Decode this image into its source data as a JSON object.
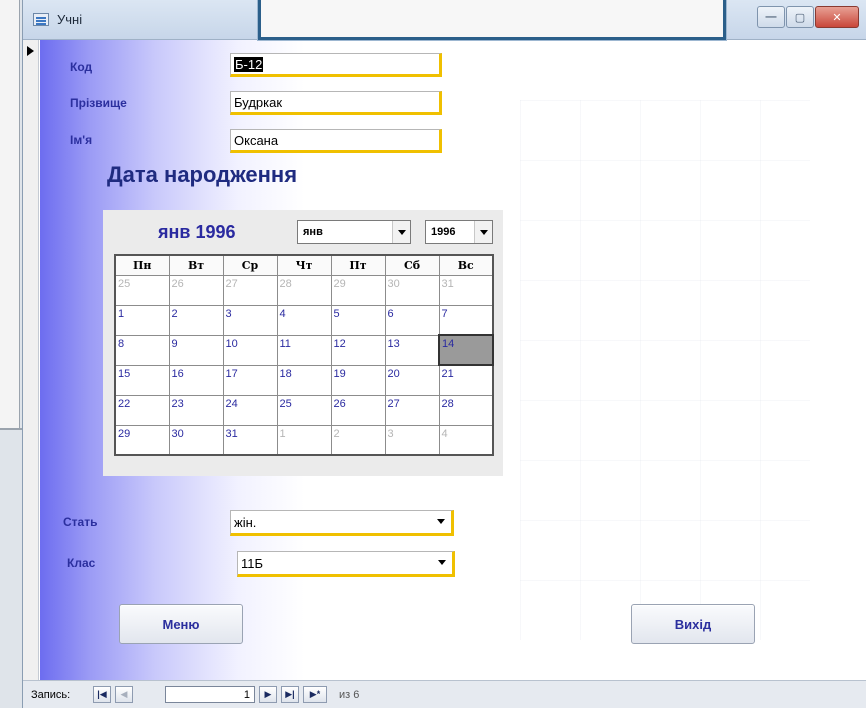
{
  "window": {
    "title": "Учні",
    "minimize": "—",
    "maximize": "▢",
    "close": "✕"
  },
  "form": {
    "code_label": "Код",
    "code_value": "Б-12",
    "surname_label": "Прізвище",
    "surname_value": "Будркак",
    "name_label": "Ім'я",
    "name_value": "Оксана",
    "dob_heading": "Дата народження",
    "gender_label": "Стать",
    "gender_value": "жін.",
    "class_label": "Клас",
    "class_value": "11Б",
    "menu_button": "Меню",
    "exit_button": "Вихід"
  },
  "calendar": {
    "month_title": "янв 1996",
    "month_select": "янв",
    "year_select": "1996",
    "weekdays": [
      "Пн",
      "Вт",
      "Ср",
      "Чт",
      "Пт",
      "Сб",
      "Вс"
    ],
    "weeks": [
      [
        {
          "d": "25",
          "t": "oth"
        },
        {
          "d": "26",
          "t": "oth"
        },
        {
          "d": "27",
          "t": "oth"
        },
        {
          "d": "28",
          "t": "oth"
        },
        {
          "d": "29",
          "t": "oth"
        },
        {
          "d": "30",
          "t": "oth"
        },
        {
          "d": "31",
          "t": "oth"
        }
      ],
      [
        {
          "d": "1",
          "t": "cur"
        },
        {
          "d": "2",
          "t": "cur"
        },
        {
          "d": "3",
          "t": "cur"
        },
        {
          "d": "4",
          "t": "cur"
        },
        {
          "d": "5",
          "t": "cur"
        },
        {
          "d": "6",
          "t": "cur"
        },
        {
          "d": "7",
          "t": "cur"
        }
      ],
      [
        {
          "d": "8",
          "t": "cur"
        },
        {
          "d": "9",
          "t": "cur"
        },
        {
          "d": "10",
          "t": "cur"
        },
        {
          "d": "11",
          "t": "cur"
        },
        {
          "d": "12",
          "t": "cur"
        },
        {
          "d": "13",
          "t": "cur"
        },
        {
          "d": "14",
          "t": "sel"
        }
      ],
      [
        {
          "d": "15",
          "t": "cur"
        },
        {
          "d": "16",
          "t": "cur"
        },
        {
          "d": "17",
          "t": "cur"
        },
        {
          "d": "18",
          "t": "cur"
        },
        {
          "d": "19",
          "t": "cur"
        },
        {
          "d": "20",
          "t": "cur"
        },
        {
          "d": "21",
          "t": "cur"
        }
      ],
      [
        {
          "d": "22",
          "t": "cur"
        },
        {
          "d": "23",
          "t": "cur"
        },
        {
          "d": "24",
          "t": "cur"
        },
        {
          "d": "25",
          "t": "cur"
        },
        {
          "d": "26",
          "t": "cur"
        },
        {
          "d": "27",
          "t": "cur"
        },
        {
          "d": "28",
          "t": "cur"
        }
      ],
      [
        {
          "d": "29",
          "t": "cur"
        },
        {
          "d": "30",
          "t": "cur"
        },
        {
          "d": "31",
          "t": "cur"
        },
        {
          "d": "1",
          "t": "oth"
        },
        {
          "d": "2",
          "t": "oth"
        },
        {
          "d": "3",
          "t": "oth"
        },
        {
          "d": "4",
          "t": "oth"
        }
      ]
    ]
  },
  "navbar": {
    "record_label": "Запись:",
    "current_record": "1",
    "of_total": "из 6",
    "first_icon": "|◀",
    "prev_icon": "◀",
    "next_icon": "▶",
    "last_icon": "▶|",
    "new_icon": "▶*"
  },
  "colors": {
    "label": "#2b2f9e",
    "field_accent": "#f0c000",
    "heading": "#1f2b80"
  }
}
